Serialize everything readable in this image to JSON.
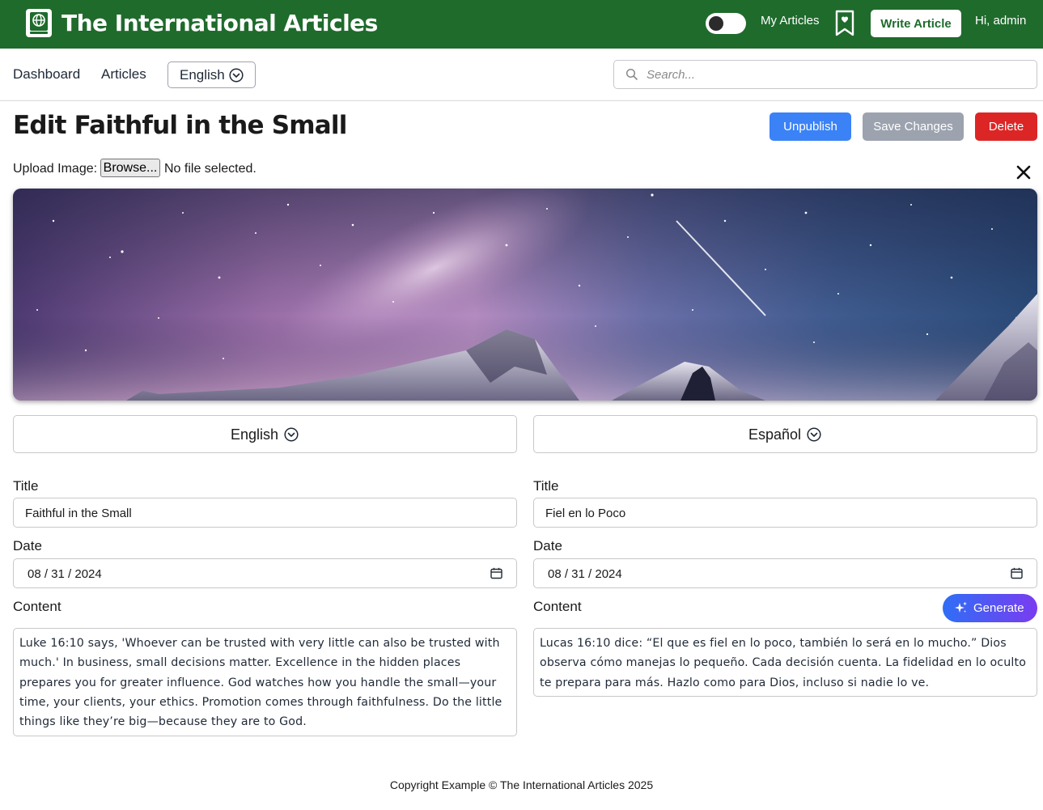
{
  "header": {
    "brand": "The International Articles",
    "my_articles": "My Articles",
    "write_article": "Write Article",
    "greeting": "Hi, admin",
    "theme_toggle_on": false,
    "bg_color": "#1f6b2c"
  },
  "nav": {
    "dashboard": "Dashboard",
    "articles": "Articles",
    "language": "English",
    "search_placeholder": "Search..."
  },
  "page": {
    "title": "Edit Faithful in the Small",
    "unpublish": "Unpublish",
    "save_changes": "Save Changes",
    "delete": "Delete",
    "upload_label": "Upload Image:",
    "browse": "Browse...",
    "file_status": "No file selected."
  },
  "left": {
    "language": "English",
    "title_label": "Title",
    "title_value": "Faithful in the Small",
    "date_label": "Date",
    "date_value": "08 / 31 / 2024",
    "content_label": "Content",
    "content": "Luke 16:10 says, 'Whoever can be trusted with very little can also be trusted with much.' In business, small decisions matter. Excellence in the hidden places prepares you for greater influence. God watches how you handle the small—your time, your clients, your ethics. Promotion comes through faithfulness. Do the little things like they’re big—because they are to God."
  },
  "right": {
    "language": "Español",
    "title_label": "Title",
    "title_value": "Fiel en lo Poco",
    "date_label": "Date",
    "date_value": "08 / 31 / 2024",
    "content_label": "Content",
    "generate": "Generate",
    "content": "Lucas 16:10 dice: “El que es fiel en lo poco, también lo será en lo mucho.” Dios observa cómo manejas lo pequeño. Cada decisión cuenta. La fidelidad en lo oculto te prepara para más. Hazlo como para Dios, incluso si nadie lo ve."
  },
  "footer": {
    "text": "Copyright Example © The International Articles 2025"
  },
  "colors": {
    "primary_green": "#1f6b2c",
    "unpublish_blue": "#3b82f6",
    "save_gray": "#9ca3af",
    "delete_red": "#dc2626"
  }
}
